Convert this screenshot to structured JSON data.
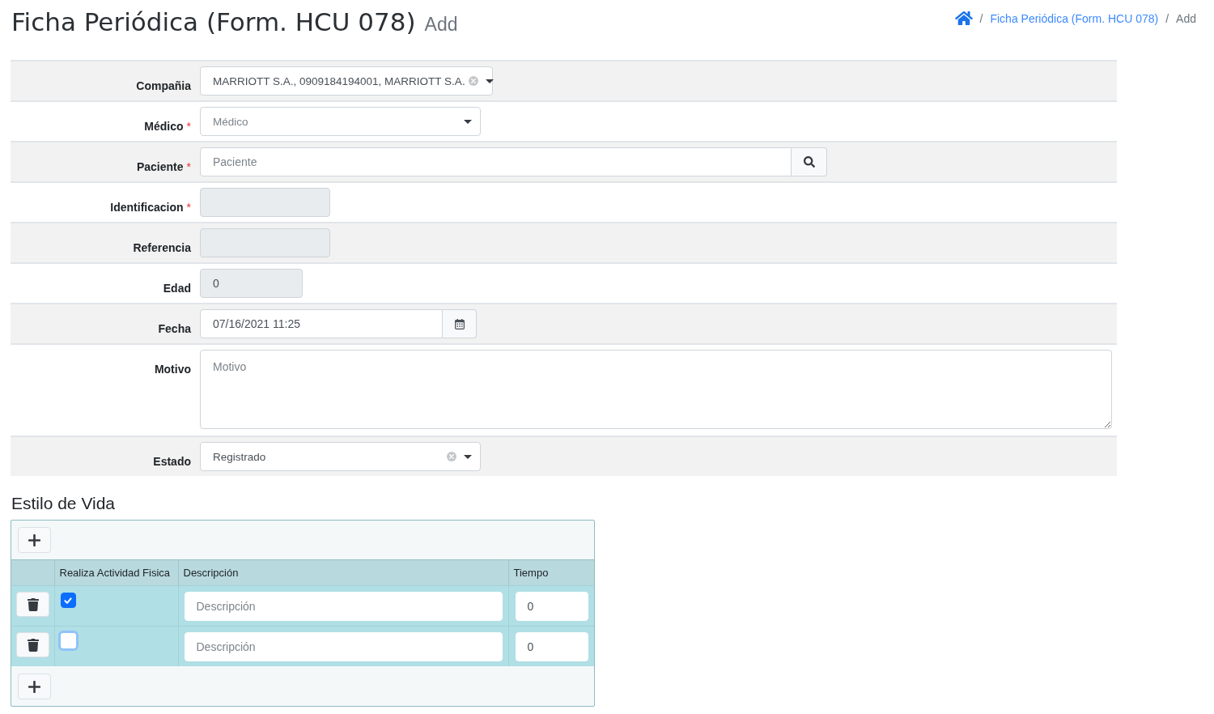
{
  "header": {
    "title": "Ficha Periódica (Form. HCU 078)",
    "subtitle": "Add"
  },
  "breadcrumb": [
    {
      "kind": "home"
    },
    {
      "kind": "link",
      "separator": "/",
      "label": "Ficha Periódica (Form. HCU 078)"
    },
    {
      "kind": "current",
      "separator": "/",
      "label": "Add"
    }
  ],
  "form": {
    "fields": [
      {
        "kind": "select",
        "label": "Compañia",
        "value": "MARRIOTT S.A., 0909184194001, MARRIOTT S.A.",
        "clearable": true,
        "disabled": false
      },
      {
        "kind": "select",
        "label": "Médico",
        "required_mark": "*",
        "placeholder": "Médico",
        "clearable": false,
        "disabled": false
      },
      {
        "kind": "search",
        "label": "Paciente",
        "required_mark": "*",
        "placeholder": "Paciente",
        "disabled": false
      },
      {
        "kind": "text",
        "label": "Identificacion",
        "required_mark": "*",
        "disabled": true
      },
      {
        "kind": "text",
        "label": "Referencia",
        "disabled": true
      },
      {
        "kind": "text",
        "label": "Edad",
        "value": "0",
        "disabled": true
      },
      {
        "kind": "date",
        "label": "Fecha",
        "value": "07/16/2021 11:25",
        "disabled": false
      },
      {
        "kind": "textarea",
        "label": "Motivo",
        "placeholder": "Motivo",
        "disabled": false
      },
      {
        "kind": "select",
        "label": "Estado",
        "value": "Registrado",
        "clearable": true,
        "disabled": false
      }
    ]
  },
  "lifestyle": {
    "title": "Estilo de Vida",
    "columns": [
      "Realiza Actividad Fisica",
      "Descripción",
      "Tiempo"
    ],
    "rows": [
      {
        "checked": true,
        "focused": false,
        "description": {
          "placeholder": "Descripción"
        },
        "tiempo": {
          "value": "0"
        }
      },
      {
        "checked": false,
        "focused": true,
        "description": {
          "placeholder": "Descripción"
        },
        "tiempo": {
          "value": "0"
        }
      }
    ]
  }
}
